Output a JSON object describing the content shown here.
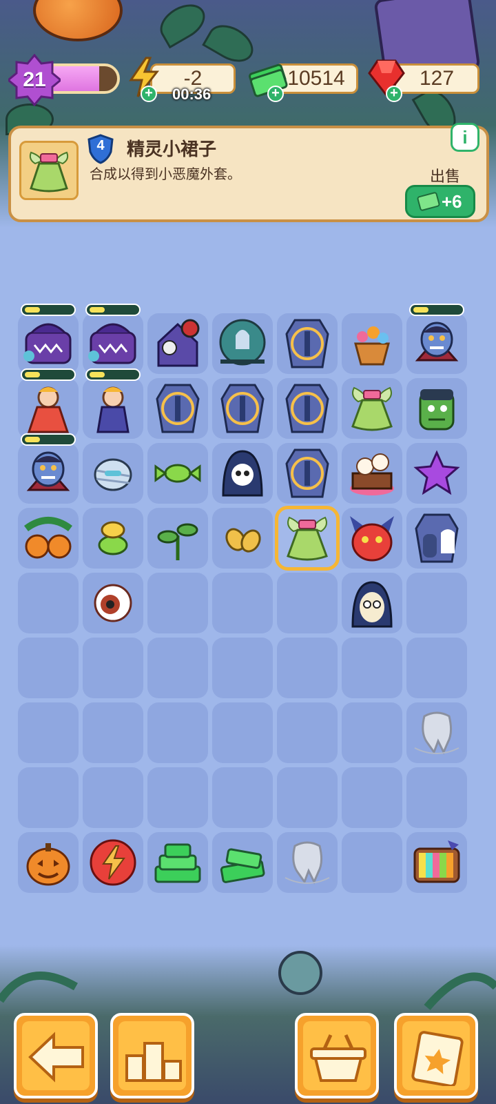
{
  "status": {
    "level": "21",
    "xp_progress": 0.72,
    "energy_value": "-2",
    "energy_timer": "00:36",
    "cash_value": "10514",
    "gems_value": "127"
  },
  "info": {
    "item_level": "4",
    "item_name": "精灵小裙子",
    "item_desc": "合成以得到小恶魔外套。",
    "sell_label": "出售",
    "sell_value": "+6",
    "info_icon": "i"
  },
  "colors": {
    "accent_green": "#2fb36a",
    "accent_orange": "#f6a12c",
    "board_bg": "#9fb7ea",
    "cell_bg": "#8fa7e0"
  },
  "board": {
    "rows": [
      [
        "monster-chest-generator",
        "monster-chest-generator",
        "haunted-house",
        "ghost-crystal-ball",
        "locked-coffin",
        "flower-basket",
        "vampire-head"
      ],
      [
        "princess-costume",
        "wizard-costume",
        "locked-coffin",
        "locked-coffin",
        "locked-coffin",
        "fairy-skirt",
        "frankenstein-head"
      ],
      [
        "vampire-head",
        "mummy-head",
        "green-candy",
        "grim-reaper-head",
        "locked-coffin",
        "ghost-cake",
        "purple-star"
      ],
      [
        "pumpkin-patch",
        "candy-bundle",
        "sprout",
        "seeds",
        "fairy-skirt-selected",
        "devil-mask",
        "coffin-ghosts"
      ],
      [
        "",
        "eyeball",
        "",
        "",
        "",
        "nun-mummy",
        ""
      ],
      [
        "",
        "",
        "",
        "",
        "",
        "",
        ""
      ],
      [
        "",
        "",
        "",
        "",
        "",
        "",
        "tooth-web"
      ],
      [
        "",
        "",
        "",
        "",
        "",
        "",
        ""
      ],
      [
        "jack-o-lantern",
        "energy-orb",
        "cash-pile-large",
        "cash-pile-small",
        "tooth-web",
        "",
        "tv-ad"
      ]
    ]
  },
  "bottom_nav": [
    "back-arrow-icon",
    "leaderboard-icon",
    "basket-icon",
    "task-clipboard-icon"
  ]
}
